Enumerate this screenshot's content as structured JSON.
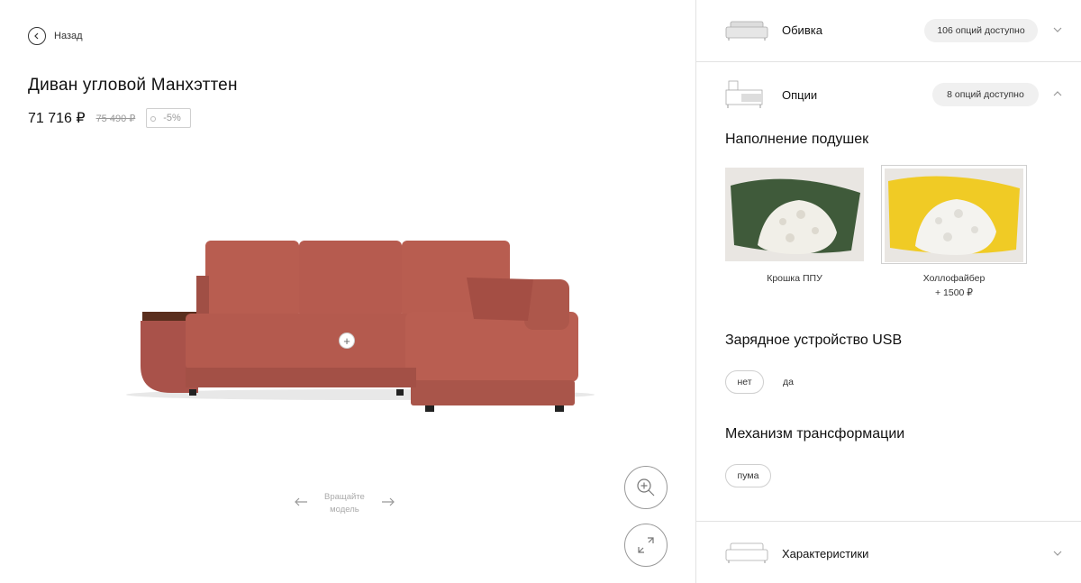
{
  "nav": {
    "back_label": "Назад"
  },
  "product": {
    "title": "Диван угловой Манхэттен",
    "price": "71 716 ₽",
    "old_price": "75 490 ₽",
    "discount": "-5%"
  },
  "viewer": {
    "rotate_label_line1": "Вращайте",
    "rotate_label_line2": "модель"
  },
  "panel": {
    "upholstery": {
      "title": "Обивка",
      "count": "106 опций доступно"
    },
    "options": {
      "title": "Опции",
      "count": "8 опций доступно"
    },
    "specs": {
      "title": "Характеристики"
    }
  },
  "filling": {
    "title": "Наполнение подушек",
    "items": [
      {
        "label": "Крошка ППУ",
        "price": "",
        "color": "#3f5a3a",
        "selected": false
      },
      {
        "label": "Холлофайбер",
        "price": "+ 1500 ₽",
        "color": "#f0cb25",
        "selected": true
      }
    ]
  },
  "usb": {
    "title": "Зарядное устройство USB",
    "options": [
      "нет",
      "да"
    ],
    "selected": "нет"
  },
  "mechanism": {
    "title": "Механизм трансформации",
    "options": [
      "пума"
    ],
    "selected": "пума"
  },
  "colors": {
    "sofa": "#b5594c",
    "sofa_shadow": "#9c4a3f",
    "accent_text": "#111111"
  }
}
